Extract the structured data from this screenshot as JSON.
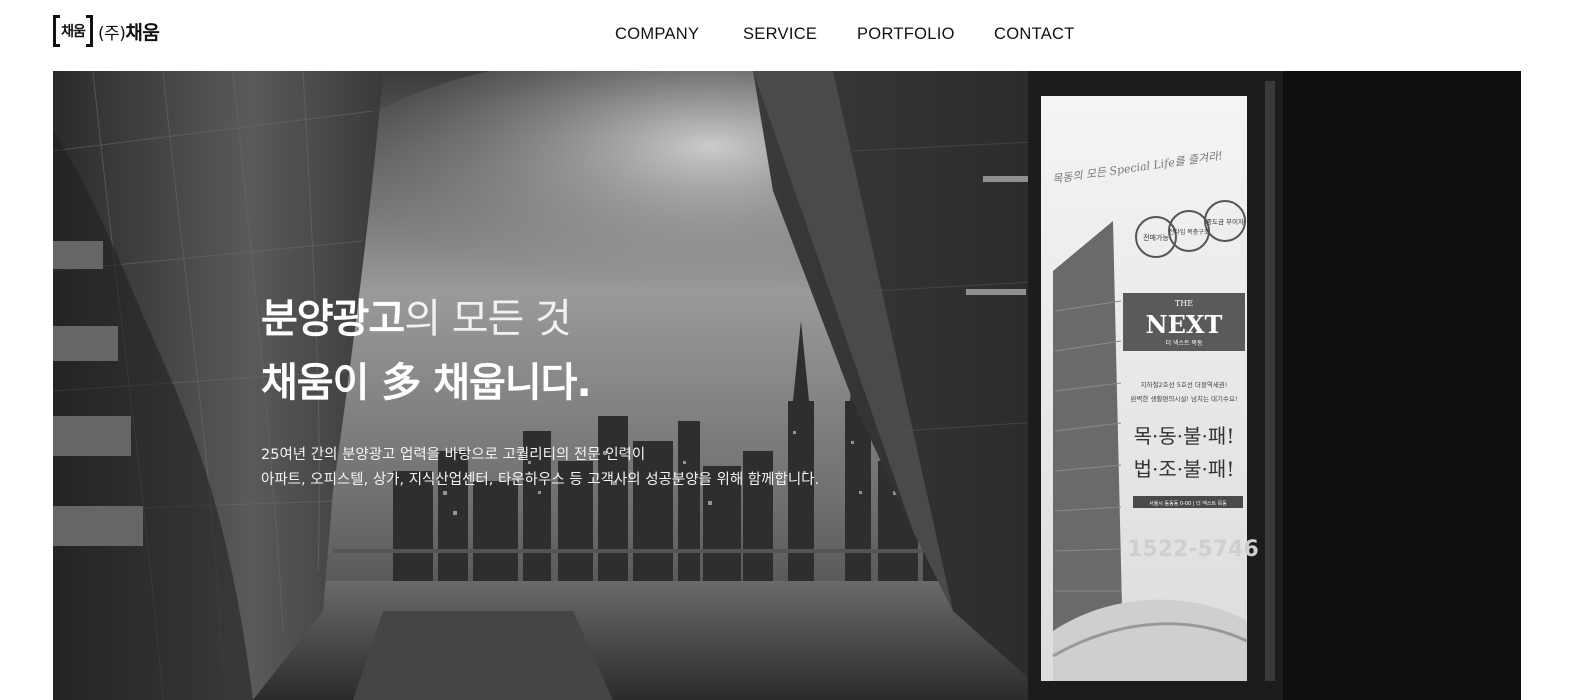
{
  "header": {
    "logo": {
      "mark_text": "채움",
      "paren_text": "(주)",
      "name_text": "채움"
    },
    "nav": [
      {
        "label": "COMPANY"
      },
      {
        "label": "SERVICE"
      },
      {
        "label": "PORTFOLIO"
      },
      {
        "label": "CONTACT"
      }
    ]
  },
  "hero": {
    "headline_line1_strong": "분양광고",
    "headline_line1_light": "의 모든 것",
    "headline_line2": "채움이 多 채웁니다.",
    "description_line1": "25여년 간의 분양광고 업력을 바탕으로 고퀄리티의 전문 인력이",
    "description_line2": "아파트, 오피스텔, 상가, 지식산업센터, 타운하우스 등 고객사의 성공분양을 위해 함께합니다.",
    "billboard": {
      "top_tagline": "목동의 모든 Special Life를 즐겨라!",
      "badges": [
        "전매가능",
        "전타입 복층구조",
        "중도금 무이자"
      ],
      "brand_small": "THE",
      "brand_large": "NEXT",
      "brand_sub": "더 넥스트 목동",
      "promo_line1": "지하철2호선 5호선 더블역세권!",
      "promo_line2": "완벽한 생활편의시설! 넘치는 대기수요!",
      "slogan_line1": "목·동·불·패!",
      "slogan_line2": "법·조·불·패!",
      "footer_strip": "서울시 동동동 0-00 | 더 넥스트 목동",
      "phone": "1522-5746"
    }
  }
}
